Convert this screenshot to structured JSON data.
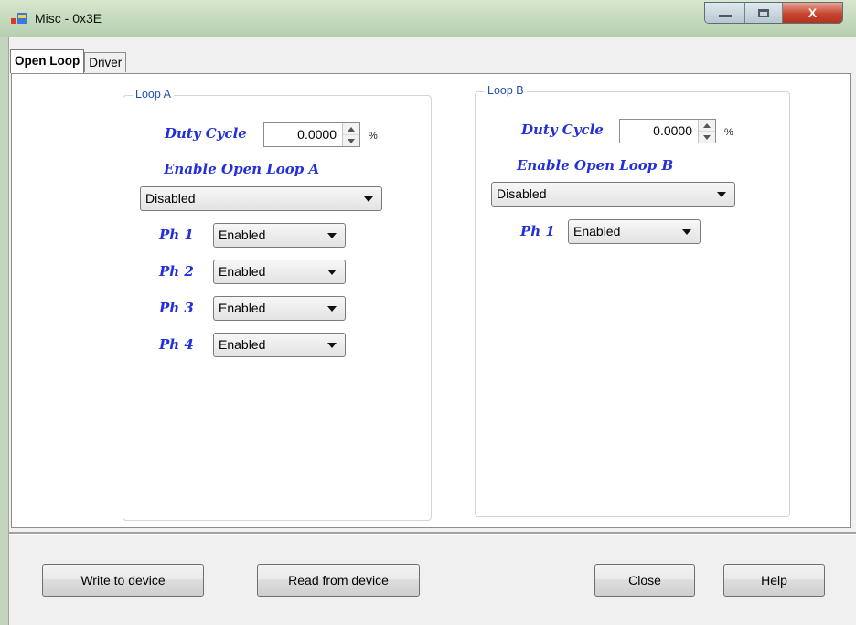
{
  "window": {
    "title": "Misc - 0x3E",
    "close_glyph": "X"
  },
  "tabs": [
    {
      "label": "Open Loop",
      "active": true
    },
    {
      "label": "Driver",
      "active": false
    }
  ],
  "loop_a": {
    "legend": "Loop A",
    "duty_cycle_label": "Duty Cycle",
    "duty_cycle_value": "0.0000",
    "duty_cycle_unit": "%",
    "enable_label": "Enable Open Loop A",
    "enable_value": "Disabled",
    "phases": [
      {
        "label": "Ph 1",
        "value": "Enabled"
      },
      {
        "label": "Ph 2",
        "value": "Enabled"
      },
      {
        "label": "Ph 3",
        "value": "Enabled"
      },
      {
        "label": "Ph 4",
        "value": "Enabled"
      }
    ]
  },
  "loop_b": {
    "legend": "Loop B",
    "duty_cycle_label": "Duty Cycle",
    "duty_cycle_value": "0.0000",
    "duty_cycle_unit": "%",
    "enable_label": "Enable Open Loop B",
    "enable_value": "Disabled",
    "phases": [
      {
        "label": "Ph 1",
        "value": "Enabled"
      }
    ]
  },
  "buttons": {
    "write": "Write to device",
    "read": "Read from device",
    "close": "Close",
    "help": "Help"
  },
  "colors": {
    "label_blue": "#2330d8",
    "legend_blue": "#1f4fb0"
  }
}
